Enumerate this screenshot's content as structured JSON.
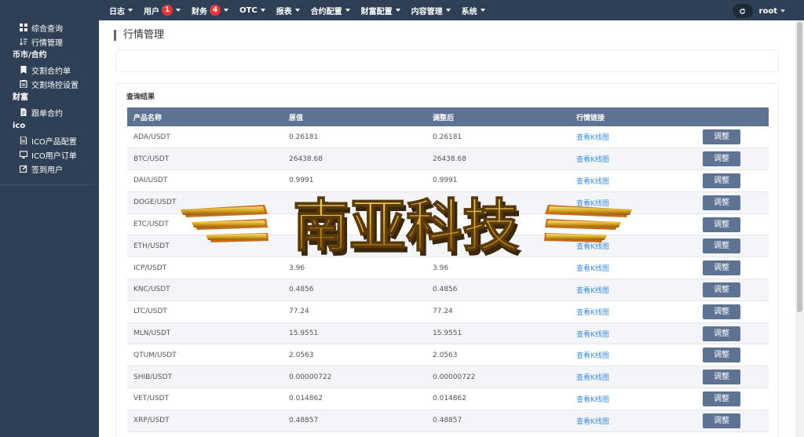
{
  "topnav": {
    "items": [
      {
        "label": "日志"
      },
      {
        "label": "用户",
        "badge": "1"
      },
      {
        "label": "财务",
        "badge": "4"
      },
      {
        "label": "OTC"
      },
      {
        "label": "报表"
      },
      {
        "label": "合约配置"
      },
      {
        "label": "财富配置"
      },
      {
        "label": "内容管理"
      },
      {
        "label": "系统"
      }
    ],
    "username": "root"
  },
  "sidebar": {
    "item_overview": "综合查询",
    "item_market": "行情管理",
    "group_contract": "币市/合约",
    "item_trade_orders": "交割合约单",
    "item_trade_control": "交割场控设置",
    "group_wealth": "财富",
    "item_follow_order": "跟单合约",
    "group_ico": "ico",
    "item_ico_config": "ICO产品配置",
    "item_ico_orders": "ICO用户订单",
    "item_signin_users": "签到用户"
  },
  "main": {
    "title": "行情管理",
    "results_title": "查询结果",
    "columns": [
      "产品名称",
      "原值",
      "调整后",
      "行情链接",
      ""
    ],
    "link_label": "查看K线图",
    "button_label": "调整",
    "rows": [
      {
        "name": "ADA/USDT",
        "original": "0.26181",
        "adjusted": "0.26181"
      },
      {
        "name": "BTC/USDT",
        "original": "26438.68",
        "adjusted": "26438.68"
      },
      {
        "name": "DAI/USDT",
        "original": "0.9991",
        "adjusted": "0.9991"
      },
      {
        "name": "DOGE/USDT",
        "original": "",
        "adjusted": ""
      },
      {
        "name": "ETC/USDT",
        "original": "",
        "adjusted": ""
      },
      {
        "name": "ETH/USDT",
        "original": "",
        "adjusted": ""
      },
      {
        "name": "ICP/USDT",
        "original": "3.96",
        "adjusted": "3.96"
      },
      {
        "name": "KNC/USDT",
        "original": "0.4856",
        "adjusted": "0.4856"
      },
      {
        "name": "LTC/USDT",
        "original": "77.24",
        "adjusted": "77.24"
      },
      {
        "name": "MLN/USDT",
        "original": "15.9551",
        "adjusted": "15.9551"
      },
      {
        "name": "QTUM/USDT",
        "original": "2.0563",
        "adjusted": "2.0563"
      },
      {
        "name": "SHIB/USDT",
        "original": "0.00000722",
        "adjusted": "0.00000722"
      },
      {
        "name": "VET/USDT",
        "original": "0.014862",
        "adjusted": "0.014862"
      },
      {
        "name": "XRP/USDT",
        "original": "0.48857",
        "adjusted": "0.48857"
      }
    ]
  },
  "watermark": {
    "text": "南亚科技"
  },
  "colors": {
    "nav_bg": "#2f4056",
    "table_header": "#5e7393",
    "badge": "#e53935",
    "link": "#3c8dde"
  }
}
